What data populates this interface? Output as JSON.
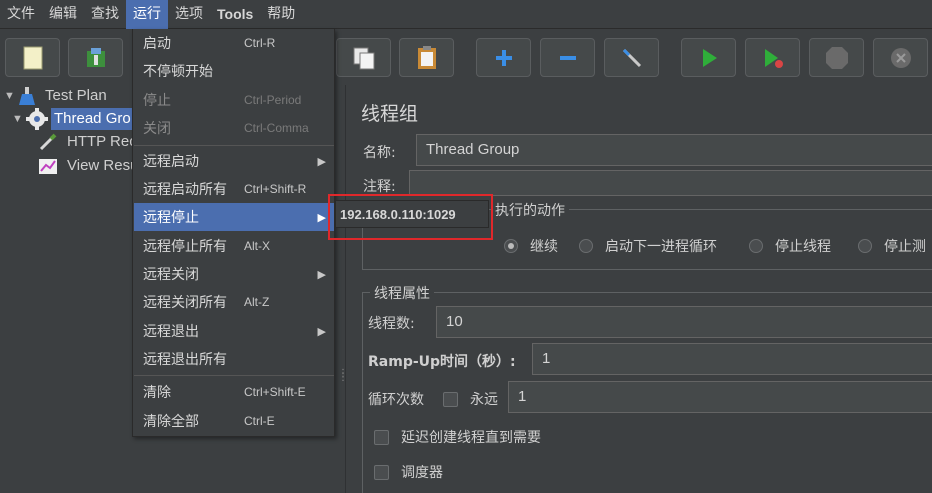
{
  "menubar": [
    "文件",
    "编辑",
    "查找",
    "运行",
    "选项",
    "Tools",
    "帮助"
  ],
  "tree": {
    "items": [
      "Test Plan",
      "Thread Gro",
      "HTTP Rec",
      "View Resu"
    ]
  },
  "panel": {
    "title": "线程组",
    "name_label": "名称:",
    "name_value": "Thread Group",
    "comment_label": "注释:",
    "comment_value": "",
    "action_group_title": "执行的动作",
    "actions": [
      "继续",
      "启动下一进程循环",
      "停止线程",
      "停止测"
    ],
    "props_group_title": "线程属性",
    "threads_label": "线程数:",
    "threads_value": "10",
    "rampup_label": "Ramp-Up时间（秒）:",
    "rampup_value": "1",
    "loop_label": "循环次数",
    "forever_label": "永远",
    "loop_value": "1",
    "delay_label": "延迟创建线程直到需要",
    "scheduler_label": "调度器"
  },
  "dropdown": {
    "items": [
      {
        "label": "启动",
        "shortcut": "Ctrl-R"
      },
      {
        "label": "不停顿开始",
        "shortcut": ""
      },
      {
        "label": "停止",
        "shortcut": "Ctrl-Period"
      },
      {
        "label": "关闭",
        "shortcut": "Ctrl-Comma"
      },
      {
        "label": "远程启动",
        "shortcut": ""
      },
      {
        "label": "远程启动所有",
        "shortcut": "Ctrl+Shift-R"
      },
      {
        "label": "远程停止",
        "shortcut": ""
      },
      {
        "label": "远程停止所有",
        "shortcut": "Alt-X"
      },
      {
        "label": "远程关闭",
        "shortcut": ""
      },
      {
        "label": "远程关闭所有",
        "shortcut": "Alt-Z"
      },
      {
        "label": "远程退出",
        "shortcut": ""
      },
      {
        "label": "远程退出所有",
        "shortcut": ""
      },
      {
        "label": "清除",
        "shortcut": "Ctrl+Shift-E"
      },
      {
        "label": "清除全部",
        "shortcut": "Ctrl-E"
      }
    ]
  },
  "submenu": {
    "item": "192.168.0.110:1029"
  },
  "colors": {
    "highlight": "#4b6eaf",
    "annotation": "#e0282b"
  }
}
